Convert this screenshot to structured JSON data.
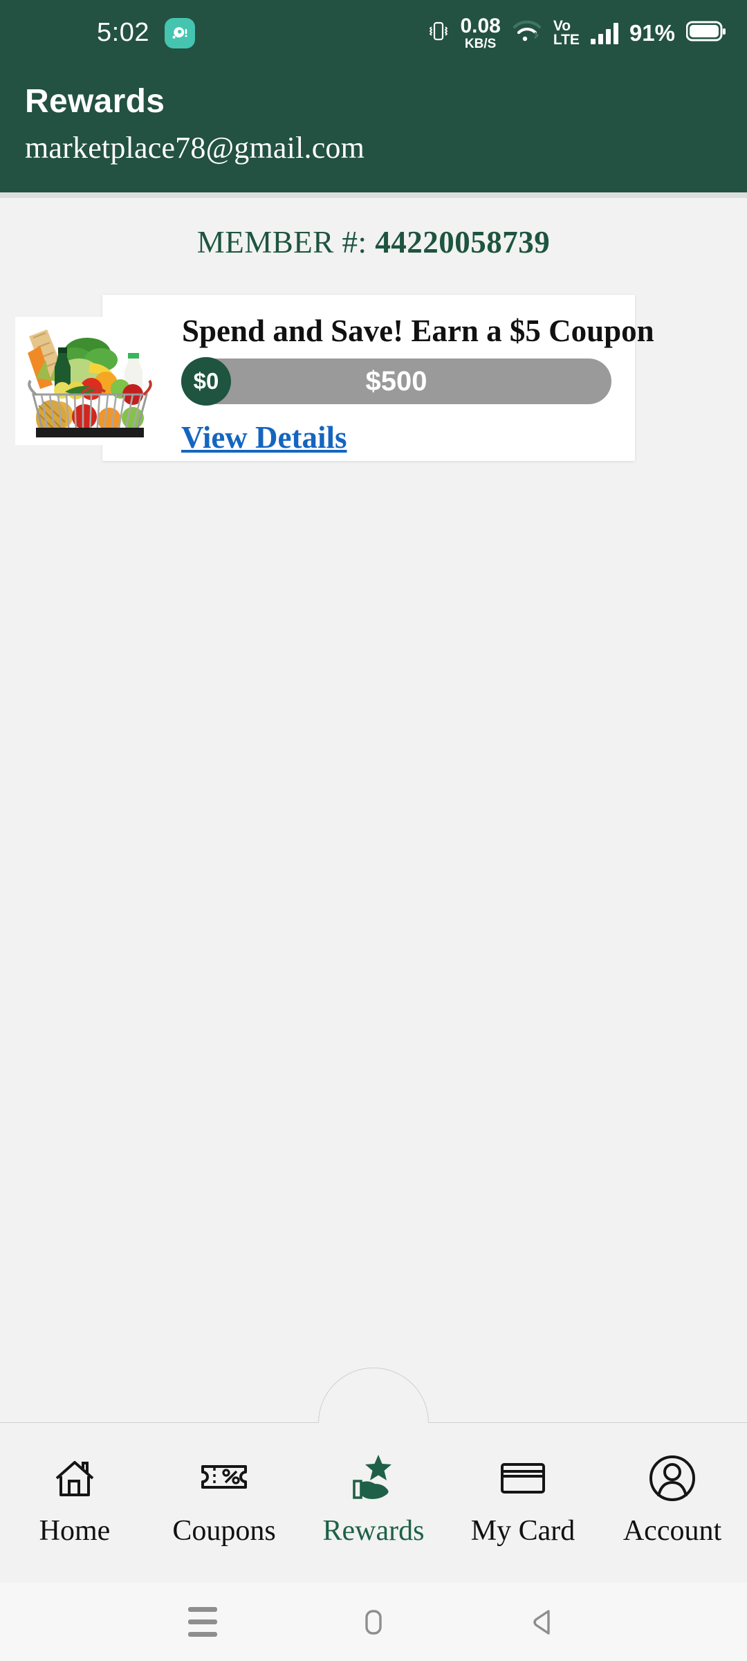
{
  "statusbar": {
    "time": "5:02",
    "app_icon": "app-notification-icon",
    "vibrate_icon": "vibrate-icon",
    "network_speed_value": "0.08",
    "network_speed_unit": "KB/S",
    "wifi_icon": "wifi-icon",
    "volte_line1": "Vo",
    "volte_line2": "LTE",
    "signal_icon": "cellular-signal-icon",
    "battery_percent": "91%",
    "battery_icon": "battery-icon"
  },
  "header": {
    "title": "Rewards",
    "email": "marketplace78@gmail.com",
    "background_color": "#235142"
  },
  "content": {
    "member_label": "MEMBER #:",
    "member_number": "44220058739",
    "card": {
      "title": "Spend and Save! Earn a $5 Coupon",
      "image_alt": "grocery-basket-image",
      "progress_current": "$0",
      "progress_goal": "$500",
      "progress_percent": 0,
      "track_color": "#9a9a9a",
      "knob_color": "#1e5440",
      "link_label": "View Details",
      "link_color": "#1565c0"
    }
  },
  "bottom_nav": {
    "active_color": "#1e6048",
    "items": [
      {
        "label": "Home",
        "icon": "house-icon",
        "active": false
      },
      {
        "label": "Coupons",
        "icon": "ticket-percent-icon",
        "active": false
      },
      {
        "label": "Rewards",
        "icon": "hand-star-icon",
        "active": true
      },
      {
        "label": "My Card",
        "icon": "credit-card-icon",
        "active": false
      },
      {
        "label": "Account",
        "icon": "person-circle-icon",
        "active": false
      }
    ]
  },
  "android_nav": {
    "recents_icon": "menu-recents-icon",
    "home_icon": "home-square-icon",
    "back_icon": "back-triangle-icon"
  }
}
